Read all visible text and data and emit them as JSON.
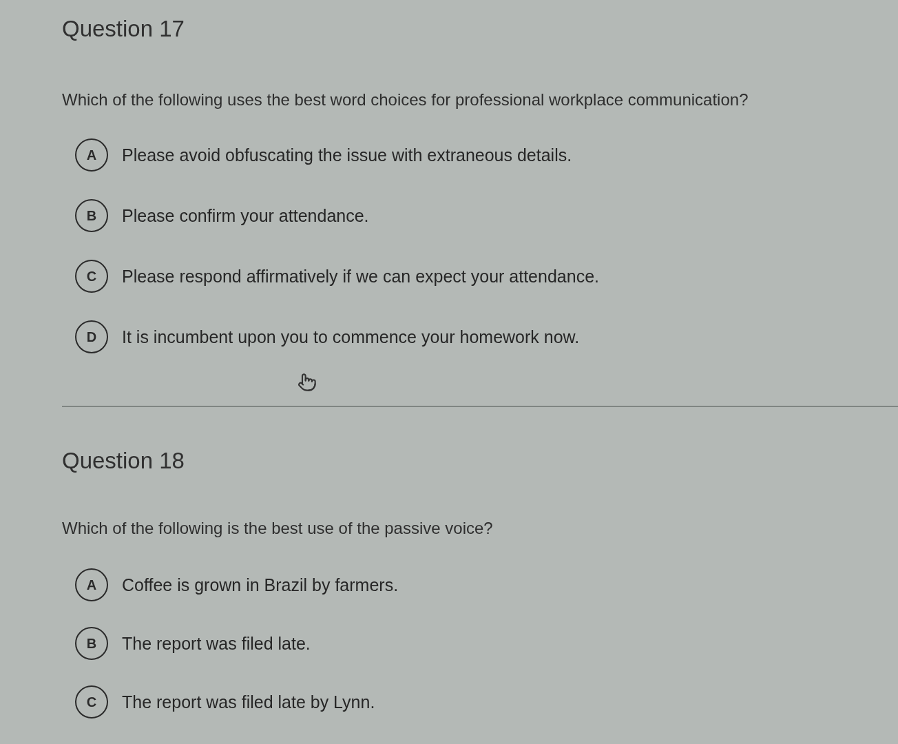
{
  "questions": [
    {
      "title": "Question 17",
      "prompt": "Which of the following uses the best word choices for professional workplace communication?",
      "options": [
        {
          "letter": "A",
          "text": "Please avoid obfuscating the issue with extraneous details.",
          "selected": false
        },
        {
          "letter": "B",
          "text": "Please confirm your attendance.",
          "selected": false
        },
        {
          "letter": "C",
          "text": "Please respond affirmatively if we can expect your attendance.",
          "selected": false
        },
        {
          "letter": "D",
          "text": "It is incumbent upon you to commence your homework now.",
          "selected": false
        }
      ]
    },
    {
      "title": "Question 18",
      "prompt": "Which of the following is the best use of the passive voice?",
      "options": [
        {
          "letter": "A",
          "text": "Coffee is grown in Brazil by farmers.",
          "selected": false
        },
        {
          "letter": "B",
          "text": "The report was filed late.",
          "selected": false
        },
        {
          "letter": "C",
          "text": "The report was filed late by Lynn.",
          "selected": false
        }
      ]
    }
  ]
}
